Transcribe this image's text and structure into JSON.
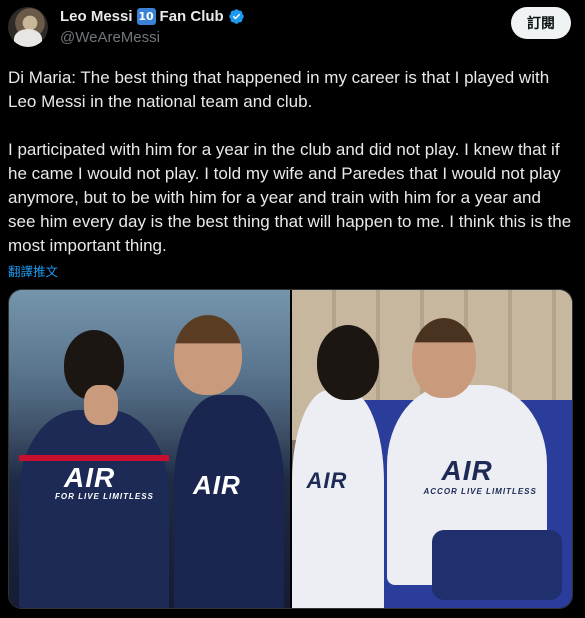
{
  "account": {
    "display_name": "Leo Messi",
    "badge_text": "10",
    "club_suffix": "Fan Club",
    "handle": "@WeAreMessi",
    "verified_color": "#1d9bf0"
  },
  "follow_button": {
    "label": "訂閱"
  },
  "tweet": {
    "text": "Di Maria: The best thing that happened in my career is that I played with Leo Messi in the national team and club.\n\nI participated with him for a year in the club and did not play. I knew that if he came I would not play. I told my wife and Paredes that I would not play anymore, but to be with him for a year and train with him for a year and see him every day is the best thing that will happen to me. I think this is the most important thing.",
    "translate_label": "翻譯推文"
  },
  "media": {
    "photos": [
      {
        "kit": "navy",
        "jersey_text": "AIR",
        "jersey_sponsor": "FOR LIVE LIMITLESS"
      },
      {
        "kit": "white",
        "jersey_text": "AIR",
        "jersey_sponsor": "ACCOR LIVE LIMITLESS"
      }
    ]
  },
  "colors": {
    "background": "#000000",
    "text": "#e7e9ea",
    "secondary": "#71767b",
    "link": "#1d9bf0"
  }
}
